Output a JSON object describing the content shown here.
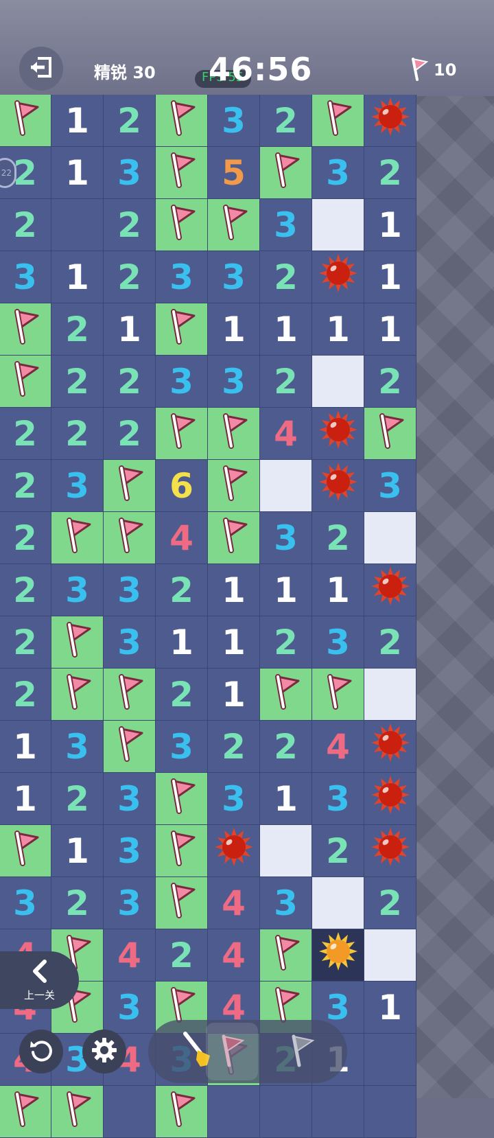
{
  "header": {
    "mode_label": "精锐 30",
    "timer": "46:56",
    "fps_overlay": "FPS 55",
    "flags_remaining": "10"
  },
  "controls": {
    "prev_level_label": "上一关",
    "side_token_label": "22"
  },
  "legend_colors": {
    "1": "#ffffff",
    "2": "#7ae3b5",
    "3": "#39c0ee",
    "4": "#ef6b83",
    "5": "#f19a4a",
    "6": "#f3e04a"
  },
  "board": {
    "cols": 8,
    "rows": [
      [
        "F",
        "1",
        "2",
        "F",
        "3",
        "2",
        "F",
        "M"
      ],
      [
        "2",
        "1",
        "3",
        "F",
        "5",
        "F",
        "3",
        "2"
      ],
      [
        "2",
        "",
        "2",
        "F",
        "F",
        "3",
        "H",
        "1"
      ],
      [
        "3",
        "1",
        "2",
        "3",
        "3",
        "2",
        "M",
        "1"
      ],
      [
        "F",
        "2",
        "1",
        "F",
        "1",
        "1",
        "1",
        "1"
      ],
      [
        "F",
        "2",
        "2",
        "3",
        "3",
        "2",
        "H",
        "2"
      ],
      [
        "2",
        "2",
        "2",
        "F",
        "F",
        "4",
        "M",
        "F"
      ],
      [
        "2",
        "3",
        "F",
        "6",
        "F",
        "H",
        "M",
        "3"
      ],
      [
        "2",
        "F",
        "F",
        "4",
        "F",
        "3",
        "2",
        "H"
      ],
      [
        "2",
        "3",
        "3",
        "2",
        "1",
        "1",
        "1",
        "M"
      ],
      [
        "2",
        "F",
        "3",
        "1",
        "1",
        "2",
        "3",
        "2"
      ],
      [
        "2",
        "F",
        "F",
        "2",
        "1",
        "F",
        "F",
        "H"
      ],
      [
        "1",
        "3",
        "F",
        "3",
        "2",
        "2",
        "4",
        "M"
      ],
      [
        "1",
        "2",
        "3",
        "F",
        "3",
        "1",
        "3",
        "M"
      ],
      [
        "F",
        "1",
        "3",
        "F",
        "M",
        "H",
        "2",
        "M"
      ],
      [
        "3",
        "2",
        "3",
        "F",
        "4",
        "3",
        "H",
        "2"
      ],
      [
        "4",
        "F",
        "4",
        "2",
        "4",
        "F",
        "X",
        "H"
      ],
      [
        "4",
        "F",
        "3",
        "F",
        "4",
        "F",
        "3",
        "1"
      ],
      [
        "4",
        "3",
        "4",
        "3",
        "F",
        "2",
        "1",
        ""
      ],
      [
        "F",
        "F",
        "",
        "F",
        "",
        "",
        "",
        ""
      ]
    ]
  },
  "toolbar": {
    "tools": [
      "shovel-tool",
      "flag-tool",
      "flag-outline-tool"
    ]
  }
}
